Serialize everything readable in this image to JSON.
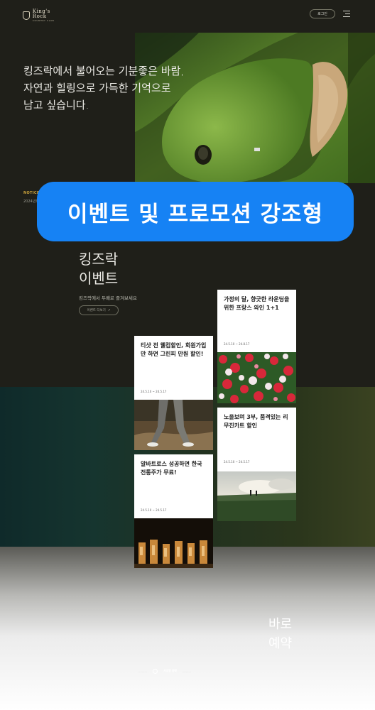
{
  "header": {
    "logo_main": "King's Rock",
    "logo_sub": "COUNTRY CLUB",
    "login_label": "로그인",
    "menu_icon": "hamburger-menu-icon"
  },
  "hero": {
    "lines": [
      "킹즈락에서 불어오는 기분좋은 바람,",
      "자연과 힐링으로 가득한 기억으로",
      "남고 싶습니다."
    ]
  },
  "notice": {
    "label": "NOTICE",
    "text": "2024년도 ..."
  },
  "banner": {
    "text": "이벤트 및 프로모션 강조형",
    "color": "#1682f4"
  },
  "events": {
    "title_line1": "킹즈락",
    "title_line2": "이벤트",
    "subtitle": "킹즈락에서 두배로 즐겨보세요",
    "more_label": "이벤트 더보기",
    "more_icon": "arrow-right-icon",
    "cards": [
      {
        "title": "가정의 달, 향긋한 라운딩을 위한 프랑스 와인 1+1",
        "date": "24.5.10 ~ 24.8.17",
        "image": "flowers"
      },
      {
        "title": "티샷 전 웰컴할인, 회원가입만 하면 그린피 만원 할인!",
        "date": "24.5.10 ~ 24.5.17",
        "image": "golfer-legs"
      },
      {
        "title": "노을보며 3부, 품격있는 리무진카트 할인",
        "date": "24.5.10 ~ 24.5.17",
        "image": "sunset-golf"
      },
      {
        "title": "알바트로스 성공하면 한국 전통주가 무료!",
        "date": "24.5.10 ~ 24.5.17",
        "image": "bottles"
      }
    ]
  },
  "bottom": {
    "reserve_line1": "바로",
    "reserve_line2": "예약",
    "pager": [
      "..........",
      "사내영 공략",
      ".........."
    ]
  }
}
